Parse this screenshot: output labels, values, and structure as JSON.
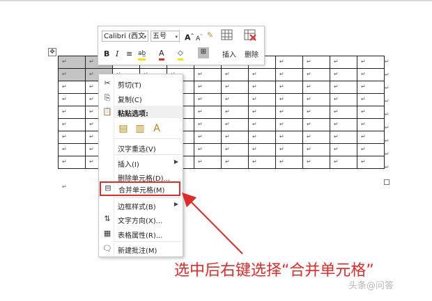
{
  "table": {
    "rows": 9,
    "cols": 12,
    "cell_mark": "↵",
    "selected_cells": [
      [
        0,
        0
      ],
      [
        0,
        1
      ],
      [
        1,
        0
      ],
      [
        1,
        1
      ]
    ]
  },
  "mini_toolbar": {
    "font_name": "Calibri (西文",
    "font_size": "五号",
    "bold": "B",
    "italic": "I",
    "insert_label": "插入",
    "delete_label": "删除"
  },
  "context_menu": {
    "cut": "剪切(T)",
    "copy": "复制(C)",
    "paste_options": "粘贴选项:",
    "reconvert": "汉字重选(V)",
    "insert": "插入(I)",
    "delete_cells": "删除单元格(D)...",
    "merge_cells": "合并单元格(M)",
    "border_styles": "边框样式(B)",
    "text_direction": "文字方向(X)...",
    "table_properties": "表格属性(R)...",
    "new_comment": "新建批注(M)"
  },
  "caption": "选中后右键选择“合并单元格”",
  "watermark": "头条@问答",
  "colors": {
    "accent_red": "#e02b2b",
    "selection_gray": "#c4c4c4"
  }
}
